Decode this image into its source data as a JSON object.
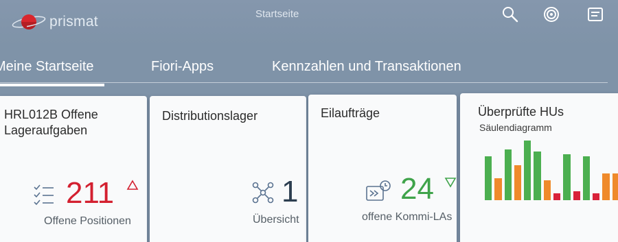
{
  "header": {
    "brand": "prismat",
    "title": "Startseite",
    "icons": [
      "search-icon",
      "notifications-icon",
      "menu-icon"
    ]
  },
  "tabs": [
    {
      "label": "Meine Startseite",
      "selected": true
    },
    {
      "label": "Fiori-Apps",
      "selected": false
    },
    {
      "label": "Kennzahlen und Transaktionen",
      "selected": false
    }
  ],
  "tiles": [
    {
      "title": "HRL012B Offene Lageraufgaben",
      "value": "211",
      "footer": "Offene Positionen",
      "icon": "task-list-icon",
      "trend": "up",
      "value_color": "#d32030"
    },
    {
      "title": "Distributionslager",
      "value": "1",
      "footer": "Übersicht",
      "icon": "network-icon",
      "value_color": "#2c3e50"
    },
    {
      "title": "Eilaufträge",
      "value": "24",
      "footer": "offene Kommi-LAs",
      "icon": "express-delivery-icon",
      "trend": "down",
      "value_color": "#3fa34a"
    },
    {
      "title": "Überprüfte HUs",
      "subtitle": "Säulendiagramm",
      "icon": "column-chart-icon"
    }
  ],
  "chart_data": {
    "type": "bar",
    "title": "Überprüfte HUs",
    "subtitle": "Säulendiagramm",
    "series_colors": [
      "#4caf50",
      "#ef8a2b",
      "#d9223a"
    ],
    "values": [
      1.0,
      0.5,
      1.15,
      0.8,
      1.35,
      1.1,
      0.45,
      0.15,
      1.05,
      0.2,
      1.0,
      0.15,
      0.6,
      0.6
    ],
    "colors": [
      "#4caf50",
      "#ef8a2b",
      "#4caf50",
      "#ef8a2b",
      "#4caf50",
      "#4caf50",
      "#ef8a2b",
      "#d9223a",
      "#4caf50",
      "#d9223a",
      "#4caf50",
      "#d9223a",
      "#ef8a2b",
      "#ef8a2b"
    ],
    "ylim": [
      0,
      1.4
    ],
    "grid": false,
    "legend": "none"
  }
}
